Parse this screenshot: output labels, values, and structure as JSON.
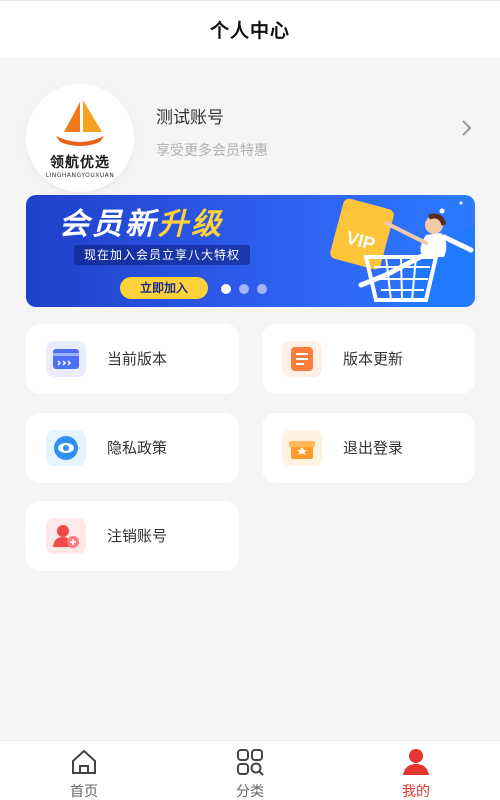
{
  "header": {
    "title": "个人中心"
  },
  "profile": {
    "logo_text": "领航优选",
    "logo_sub": "LINGHANGYOUXUAN",
    "name": "测试账号",
    "subtitle": "享受更多会员特惠"
  },
  "banner": {
    "title_part1": "会员新",
    "title_part2": "升级",
    "subtitle": "现在加入会员立享八大特权",
    "button": "立即加入",
    "art_text": "VIP",
    "slide_count": 3,
    "active_slide": 1
  },
  "menu": [
    {
      "label": "当前版本",
      "icon": "version-icon"
    },
    {
      "label": "版本更新",
      "icon": "update-icon"
    },
    {
      "label": "隐私政策",
      "icon": "privacy-icon"
    },
    {
      "label": "退出登录",
      "icon": "logout-icon"
    },
    {
      "label": "注销账号",
      "icon": "delete-account-icon"
    }
  ],
  "tabbar": [
    {
      "label": "首页",
      "icon": "home-icon"
    },
    {
      "label": "分类",
      "icon": "category-icon"
    },
    {
      "label": "我的",
      "icon": "user-icon",
      "active": true
    }
  ],
  "colors": {
    "accent": "#e8342f",
    "banner": "#2f5ff0",
    "highlight": "#ffd23a"
  }
}
